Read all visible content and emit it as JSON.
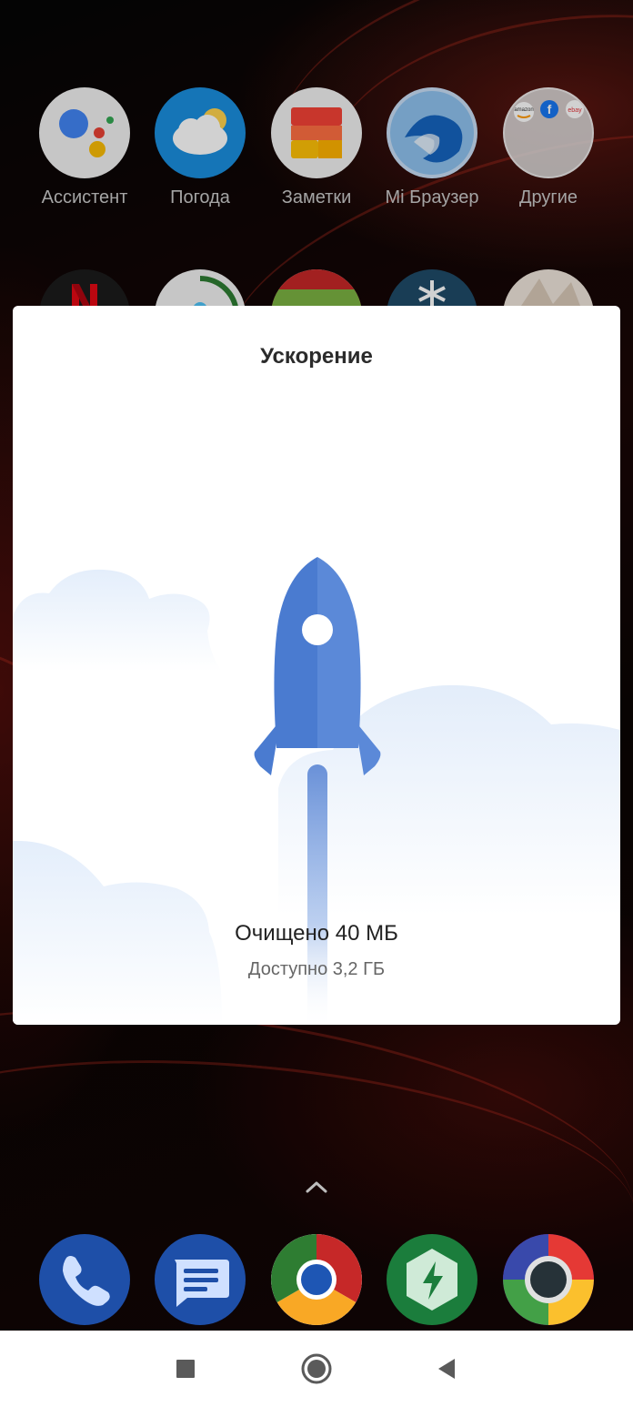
{
  "home": {
    "row1": [
      {
        "label": "Ассистент",
        "icon": "assistant-icon"
      },
      {
        "label": "Погода",
        "icon": "weather-icon"
      },
      {
        "label": "Заметки",
        "icon": "notes-icon"
      },
      {
        "label": "Mi Браузер",
        "icon": "browser-icon"
      },
      {
        "label": "Другие",
        "icon": "folder-icon"
      }
    ],
    "dock": [
      {
        "icon": "phone-icon"
      },
      {
        "icon": "messages-icon"
      },
      {
        "icon": "chrome-icon"
      },
      {
        "icon": "security-icon"
      },
      {
        "icon": "camera-icon"
      }
    ]
  },
  "dialog": {
    "title": "Ускорение",
    "cleaned_text": "Очищено 40 МБ",
    "available_text": "Доступно 3,2 ГБ"
  },
  "colors": {
    "rocket": "#4a7bd0",
    "cloud": "#e9f1fb",
    "dock_blue": "#1e4fa8"
  },
  "navigation": {
    "recents": "recents-icon",
    "home": "home-icon",
    "back": "back-icon"
  }
}
